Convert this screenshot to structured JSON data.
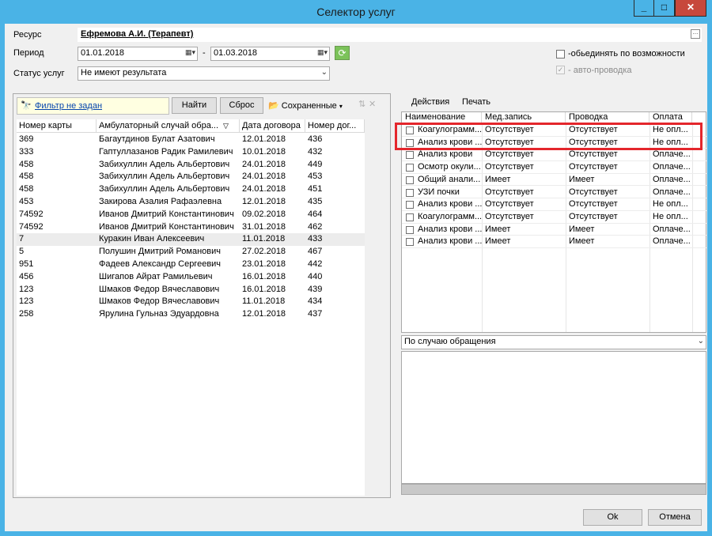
{
  "window": {
    "title": "Селектор услуг",
    "min_glyph": "_",
    "max_glyph": "□",
    "close_glyph": "✕"
  },
  "filters": {
    "resource_label": "Ресурс",
    "resource_value": "Ефремова А.И. (Терапевт)",
    "period_label": "Период",
    "period_from": "01.01.2018",
    "period_dash": "-",
    "period_to": "01.03.2018",
    "status_label": "Статус услуг",
    "status_value": "Не имеют результата",
    "combine_label": "-обьединять по возможности",
    "auto_label": "- авто-проводка"
  },
  "left_toolbar": {
    "filter_label": "Фильтр не задан",
    "find_label": "Найти",
    "reset_label": "Сброс",
    "saved_label": "Сохраненные"
  },
  "left_grid": {
    "headers": [
      "Номер карты",
      "Амбулаторный случай обра...",
      "Дата договора",
      "Номер дог..."
    ],
    "rows": [
      [
        "369",
        "Багаутдинов Булат Азатович",
        "12.01.2018",
        "436"
      ],
      [
        "333",
        "Гаптуллазанов Радик Рамилевич",
        "10.01.2018",
        "432"
      ],
      [
        "458",
        "Забихуллин Адель Альбертович",
        "24.01.2018",
        "449"
      ],
      [
        "458",
        "Забихуллин Адель Альбертович",
        "24.01.2018",
        "453"
      ],
      [
        "458",
        "Забихуллин Адель Альбертович",
        "24.01.2018",
        "451"
      ],
      [
        "453",
        "Закирова Азалия Рафаэлевна",
        "12.01.2018",
        "435"
      ],
      [
        "74592",
        "Иванов Дмитрий Константинович",
        "09.02.2018",
        "464"
      ],
      [
        "74592",
        "Иванов Дмитрий Константинович",
        "31.01.2018",
        "462"
      ],
      [
        "7",
        "Куракин Иван Алексеевич",
        "11.01.2018",
        "433"
      ],
      [
        "5",
        "Полушин Дмитрий Романович",
        "27.02.2018",
        "467"
      ],
      [
        "951",
        "Фадеев Александр Сергеевич",
        "23.01.2018",
        "442"
      ],
      [
        "456",
        "Шигапов Айрат Рамильевич",
        "16.01.2018",
        "440"
      ],
      [
        "123",
        "Шмаков Федор Вячеславович",
        "16.01.2018",
        "439"
      ],
      [
        "123",
        "Шмаков Федор Вячеславович",
        "11.01.2018",
        "434"
      ],
      [
        "258",
        "Ярулина Гульназ Эдуардовна",
        "12.01.2018",
        "437"
      ]
    ]
  },
  "right_menu": {
    "actions": "Действия",
    "print": "Печать"
  },
  "right_grid": {
    "headers": [
      "Наименование",
      "Мед.запись",
      "Проводка",
      "Оплата"
    ],
    "rows": [
      [
        "Коагулограмм...",
        "Отсутствует",
        "Отсутствует",
        "Не опл..."
      ],
      [
        "Анализ крови ...",
        "Отсутствует",
        "Отсутствует",
        "Не опл..."
      ],
      [
        "Анализ крови",
        "Отсутствует",
        "Отсутствует",
        "Оплаче..."
      ],
      [
        "Осмотр окули...",
        "Отсутствует",
        "Отсутствует",
        "Оплаче..."
      ],
      [
        "Общий анали...",
        "Имеет",
        "Имеет",
        "Оплаче..."
      ],
      [
        "УЗИ почки",
        "Отсутствует",
        "Отсутствует",
        "Оплаче..."
      ],
      [
        "Анализ крови ...",
        "Отсутствует",
        "Отсутствует",
        "Не опл..."
      ],
      [
        "Коагулограмм...",
        "Отсутствует",
        "Отсутствует",
        "Не опл..."
      ],
      [
        "Анализ крови ...",
        "Имеет",
        "Имеет",
        "Оплаче..."
      ],
      [
        "Анализ крови ...",
        "Имеет",
        "Имеет",
        "Оплаче..."
      ]
    ]
  },
  "grouping": {
    "value": "По случаю обращения"
  },
  "footer": {
    "ok": "Ok",
    "cancel": "Отмена"
  }
}
